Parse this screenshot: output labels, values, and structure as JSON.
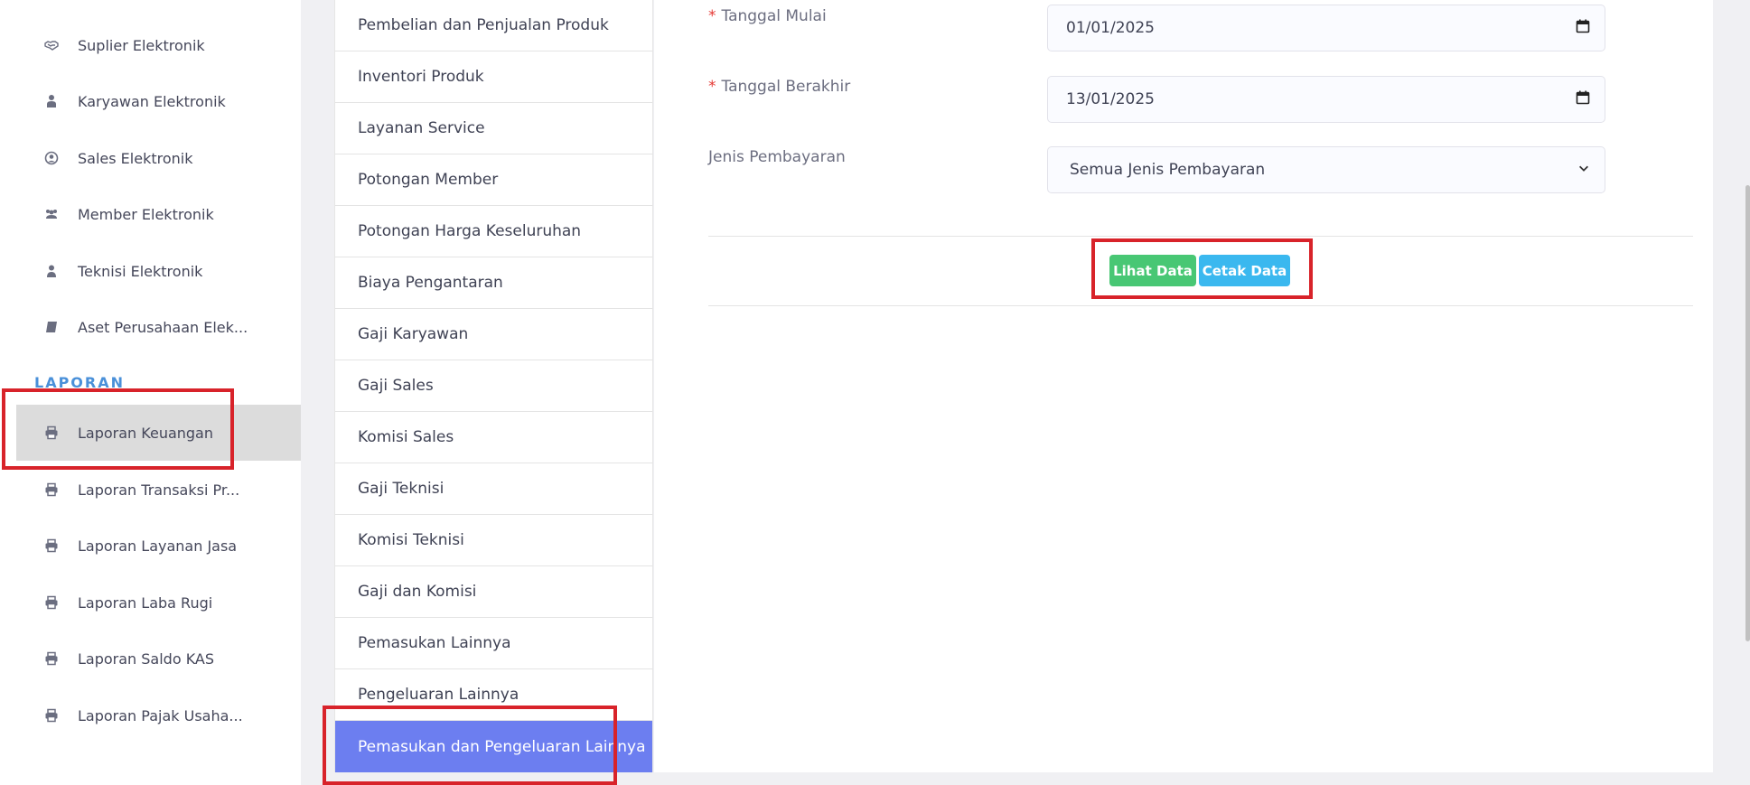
{
  "sidebar": {
    "items": [
      {
        "label": "Suplier Elektronik",
        "icon": "handshake-icon"
      },
      {
        "label": "Karyawan Elektronik",
        "icon": "user-tie-icon"
      },
      {
        "label": "Sales Elektronik",
        "icon": "user-circle-icon"
      },
      {
        "label": "Member Elektronik",
        "icon": "users-icon"
      },
      {
        "label": "Teknisi Elektronik",
        "icon": "user-icon"
      },
      {
        "label": "Aset Perusahaan Elek...",
        "icon": "book-icon"
      }
    ],
    "section": "LAPORAN",
    "reports": [
      {
        "label": "Laporan Keuangan",
        "icon": "print-icon",
        "active": true
      },
      {
        "label": "Laporan Transaksi Pr...",
        "icon": "print-icon"
      },
      {
        "label": "Laporan Layanan Jasa",
        "icon": "print-icon"
      },
      {
        "label": "Laporan Laba Rugi",
        "icon": "print-icon"
      },
      {
        "label": "Laporan Saldo KAS",
        "icon": "print-icon"
      },
      {
        "label": "Laporan Pajak Usaha...",
        "icon": "print-icon"
      }
    ]
  },
  "menu": {
    "items": [
      "Pembelian dan Penjualan Produk",
      "Inventori Produk",
      "Layanan Service",
      "Potongan Member",
      "Potongan Harga Keseluruhan",
      "Biaya Pengantaran",
      "Gaji Karyawan",
      "Gaji Sales",
      "Komisi Sales",
      "Gaji Teknisi",
      "Komisi Teknisi",
      "Gaji dan Komisi",
      "Pemasukan Lainnya",
      "Pengeluaran Lainnya",
      "Pemasukan dan Pengeluaran Lainnya"
    ],
    "active_index": 14
  },
  "form": {
    "required_mark": "*",
    "start_label": "Tanggal Mulai",
    "start_value": "01/01/2025",
    "end_label": "Tanggal Berakhir",
    "end_value": "13/01/2025",
    "payment_label": "Jenis Pembayaran",
    "payment_value": "Semua Jenis Pembayaran",
    "view_button": "Lihat Data",
    "print_button": "Cetak Data"
  },
  "colors": {
    "accent": "#6c7ef0",
    "green": "#48c774",
    "blue": "#3ab8ef",
    "highlight": "#d8232a",
    "section": "#4a90d9"
  }
}
